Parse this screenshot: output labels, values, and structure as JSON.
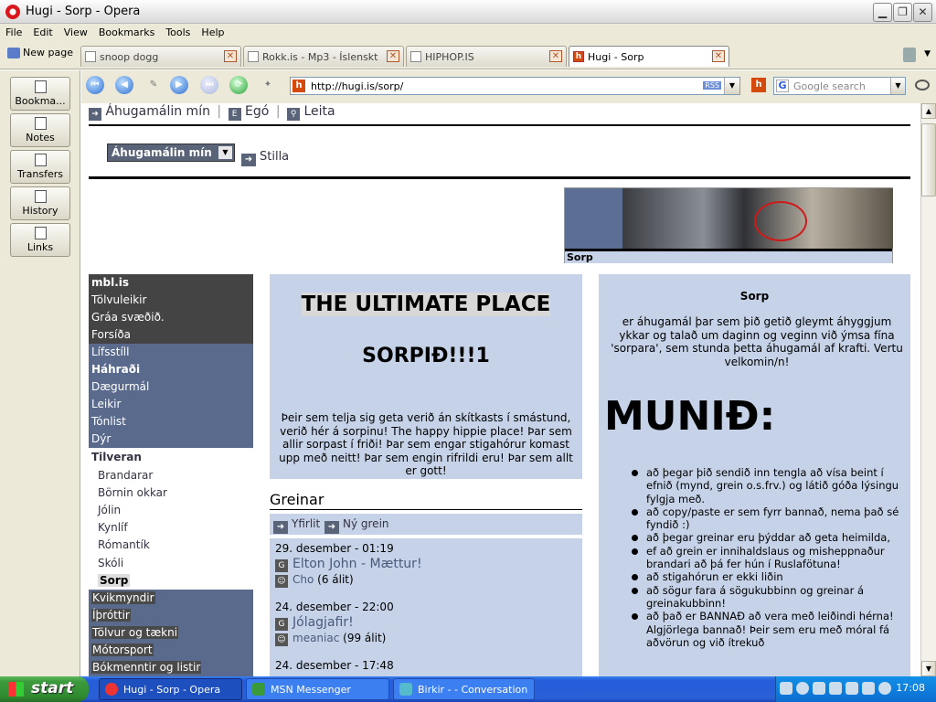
{
  "window": {
    "title": "Hugi - Sorp - Opera"
  },
  "menu": [
    "File",
    "Edit",
    "View",
    "Bookmarks",
    "Tools",
    "Help"
  ],
  "new_page": "New page",
  "tabs": [
    {
      "label": "snoop dogg"
    },
    {
      "label": "Rokk.is - Mp3 - Íslenskt t..."
    },
    {
      "label": "HIPHOP.IS"
    },
    {
      "label": "Hugi - Sorp"
    }
  ],
  "panel": [
    "Bookma...",
    "Notes",
    "Transfers",
    "History",
    "Links"
  ],
  "address": {
    "url": "http://hugi.is/sorp/",
    "rss": "RSS"
  },
  "search": {
    "placeholder": "Google search"
  },
  "page": {
    "toplinks": [
      "Áhugamálin mín",
      "Egó",
      "Leita"
    ],
    "select_value": "Áhugamálin mín",
    "stilla": "Stilla",
    "banner_caption": "Sorp",
    "leftnav": [
      {
        "label": "mbl.is",
        "style": "dark"
      },
      {
        "label": "Tölvuleikir",
        "style": "dark"
      },
      {
        "label": "Gráa svæðið.",
        "style": "dark"
      },
      {
        "label": "Forsíða",
        "style": "dark"
      },
      {
        "label": "Lífsstíll",
        "style": "blue"
      },
      {
        "label": "Háhraði",
        "style": "blue"
      },
      {
        "label": "Dægurmál",
        "style": "blue"
      },
      {
        "label": "Leikir",
        "style": "blue"
      },
      {
        "label": "Tónlist",
        "style": "blue"
      },
      {
        "label": "Dýr",
        "style": "blue"
      },
      {
        "label": "Tilveran",
        "style": "white"
      },
      {
        "label": "Brandarar",
        "style": "sub"
      },
      {
        "label": "Börnin okkar",
        "style": "sub"
      },
      {
        "label": "Jólin",
        "style": "sub"
      },
      {
        "label": "Kynlíf",
        "style": "sub"
      },
      {
        "label": "Rómantík",
        "style": "sub"
      },
      {
        "label": "Skóli",
        "style": "sub"
      },
      {
        "label": "Sorp",
        "style": "sub"
      },
      {
        "label": "Kvikmyndir",
        "style": "blue"
      },
      {
        "label": "Íþróttir",
        "style": "blue"
      },
      {
        "label": "Tölvur og tækni",
        "style": "blue"
      },
      {
        "label": "Mótorsport",
        "style": "blue"
      },
      {
        "label": "Bókmenntir og listir",
        "style": "blue"
      }
    ],
    "intro": {
      "heading1": "THE ULTIMATE PLACE",
      "heading2": "SORPIÐ!!!1",
      "text": "Þeir sem telja sig geta verið án skítkasts í smástund, verið hér á sorpinu! The happy hippie place! Þar sem allir sorpast í friði! Þar sem engar stigahórur komast upp með neitt! Þar sem engin rifrildi eru! Þar sem allt er gott!"
    },
    "greinar": {
      "title": "Greinar",
      "yfirlit": "Yfirlit",
      "ny_grein": "Ný grein",
      "entries": [
        {
          "date": "29. desember - 01:19",
          "title": "Elton John - Mættur!",
          "author": "Cho",
          "count": "(6 álit)"
        },
        {
          "date": "24. desember - 22:00",
          "title": "Jólagjafir!",
          "author": "meaniac",
          "count": "(99 álit)"
        },
        {
          "date": "24. desember - 17:48",
          "title": "",
          "author": "",
          "count": ""
        }
      ]
    },
    "right": {
      "title": "Sorp",
      "text": "er áhugamál þar sem þið getið gleymt áhyggjum ykkar og talað um daginn og veginn við ýmsa fína 'sorpara', sem stunda þetta áhugamál af krafti. Vertu velkomin/n!",
      "munid": "MUNIÐ:",
      "rules": [
        "að þegar þið sendið inn tengla að vísa beint í efnið (mynd, grein o.s.frv.) og látið góða lýsingu fylgja með.",
        "að copy/paste er sem fyrr bannað, nema það sé fyndið :)",
        "að þegar greinar eru þýddar að geta heimilda,",
        "ef að grein er innihaldslaus og misheppnaður brandari að þá fer hún í Ruslafötuna!",
        "að stigahórun er ekki liðin",
        "að sögur fara á sögukubbinn og greinar á greinakubbinn!",
        "að það er BANNAÐ að vera með leiðindi hérna! Algjörlega bannað! Þeir sem eru með móral fá aðvörun og við ítrekuð"
      ]
    }
  },
  "taskbar": {
    "start": "start",
    "items": [
      {
        "label": "Hugi - Sorp - Opera",
        "active": true
      },
      {
        "label": "MSN Messenger",
        "active": false
      },
      {
        "label": "Birkir - - Conversation",
        "active": false
      }
    ],
    "clock": "17:08"
  }
}
